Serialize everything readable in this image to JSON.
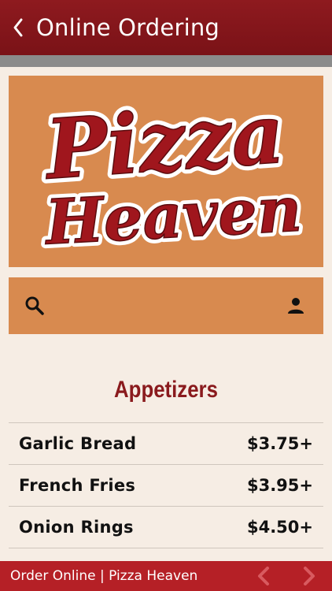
{
  "header": {
    "title": "Online Ordering",
    "back_icon": "chevron-left-icon"
  },
  "brand": {
    "logo_text_line1": "Pizza",
    "logo_text_line2": "Heaven",
    "color_primary": "#8e1a1f",
    "color_panel": "#d88a4f"
  },
  "toolbar": {
    "search_icon": "search-icon",
    "account_icon": "person-icon"
  },
  "section": {
    "title": "Appetizers"
  },
  "menu_items": [
    {
      "name": "Garlic Bread",
      "price": "$3.75+"
    },
    {
      "name": "French Fries",
      "price": "$3.95+"
    },
    {
      "name": "Onion Rings",
      "price": "$4.50+"
    }
  ],
  "footer": {
    "text": "Order Online | Pizza Heaven",
    "prev_icon": "chevron-left-icon",
    "next_icon": "chevron-right-icon"
  }
}
